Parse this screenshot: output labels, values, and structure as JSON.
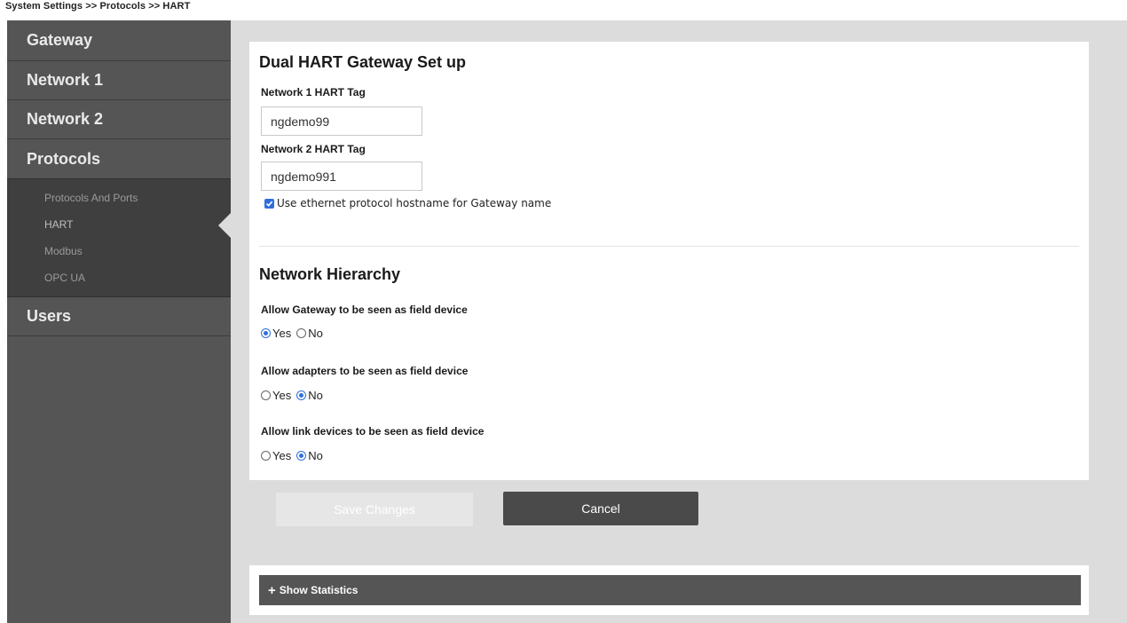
{
  "breadcrumb": "System Settings >> Protocols >> HART",
  "sidebar": {
    "items": [
      {
        "label": "Gateway"
      },
      {
        "label": "Network 1"
      },
      {
        "label": "Network 2"
      },
      {
        "label": "Protocols"
      },
      {
        "label": "Users"
      }
    ],
    "protocols_sub": [
      {
        "label": "Protocols And Ports"
      },
      {
        "label": "HART"
      },
      {
        "label": "Modbus"
      },
      {
        "label": "OPC UA"
      }
    ],
    "active_sub": "HART"
  },
  "setup": {
    "title": "Dual HART Gateway Set up",
    "net1_label": "Network 1 HART Tag",
    "net1_value": "ngdemo99",
    "net2_label": "Network 2 HART Tag",
    "net2_value": "ngdemo991",
    "checkbox_label": "Use ethernet protocol hostname for Gateway name",
    "checkbox_checked": true
  },
  "hierarchy": {
    "title": "Network Hierarchy",
    "yes_label": "Yes",
    "no_label": "No",
    "questions": [
      {
        "label": "Allow Gateway to be seen as field device",
        "selected": "Yes"
      },
      {
        "label": "Allow adapters to be seen as field device",
        "selected": "No"
      },
      {
        "label": "Allow link devices to be seen as field device",
        "selected": "No"
      }
    ]
  },
  "actions": {
    "save_label": "Save Changes",
    "save_enabled": false,
    "cancel_label": "Cancel"
  },
  "stats": {
    "label": "Show Statistics",
    "icon": "plus-icon"
  },
  "colors": {
    "accent": "#2f6fdc",
    "sidebar": "#555555",
    "cancel_button": "#4a4a4a"
  }
}
